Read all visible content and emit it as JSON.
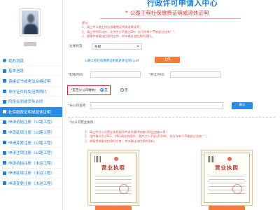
{
  "header": {
    "title": "行政许可申请入中心"
  },
  "sidebar": {
    "items": [
      {
        "label": "我的消息",
        "icon": "bell-icon"
      },
      {
        "label": "基本信息",
        "icon": "doc-icon"
      },
      {
        "label": "资格证书或考试合格证明",
        "icon": "certificate-icon"
      },
      {
        "label": "身份证件和免冠照照片",
        "icon": "id-card-icon"
      },
      {
        "label": "阶段合同或劳务合同",
        "icon": "contract-icon"
      },
      {
        "label": "社保缴费证明或退休证明",
        "icon": "shield-icon"
      },
      {
        "label": "申请初始注册（公路工程）",
        "icon": "form-icon"
      },
      {
        "label": "申请延续注册（公路工程）",
        "icon": "form-icon"
      },
      {
        "label": "申请变更注册（公路工程）",
        "icon": "form-icon"
      },
      {
        "label": "申请注销注册（公路工程）",
        "icon": "form-icon"
      },
      {
        "label": "申请初始注册（水运工程）",
        "icon": "form-icon"
      },
      {
        "label": "申请延续注册（水运工程）",
        "icon": "form-icon"
      },
      {
        "label": "申请变更注册（水运工程）",
        "icon": "form-icon"
      }
    ],
    "active_index": 5
  },
  "main": {
    "heading": "公路工程社保缴费证明或退休证明",
    "tips": {
      "title": "提示：",
      "lines": [
        "1、请上传公路工程社保缴费证明或退休证明；",
        "2、请上传PDF文件，文件大小不超过5M，仅可作单个不能超过含有“.”；",
        "3、收集并装载该信息时文件，并未确认该信息的资料。"
      ]
    },
    "social_status": {
      "label": "社保状态：",
      "value": "在职"
    },
    "file": {
      "name": "公路工程社保缴费证明或退休证明1.pdf",
      "upload_label": "上传"
    },
    "start_date": {
      "label": "*起始时间：",
      "placeholder": ""
    },
    "end_date": {
      "label": "*终止时间：",
      "placeholder": ""
    },
    "branch": {
      "label": "*是否分公司缴纳：",
      "yes": "是",
      "no": "否"
    },
    "company": {
      "label": "*分公司名称：",
      "placeholder": "",
      "confirm_label": "确认"
    },
    "notes": {
      "title": "*分公司营业执照：",
      "lines": [
        "1、请上传分公司营业执照复印件或扫描件加盖公章且加盖公章；",
        "2、文件格式为 JPEG、PNG格式的图片，图片大小不超过500K，仅可作单个不能超过含有“.”；",
        "3、收集并装载该信息时文件，并未确认该信息的资料。"
      ]
    },
    "licences": [
      {
        "title": "营业执照"
      },
      {
        "title": "营业执照"
      }
    ]
  }
}
